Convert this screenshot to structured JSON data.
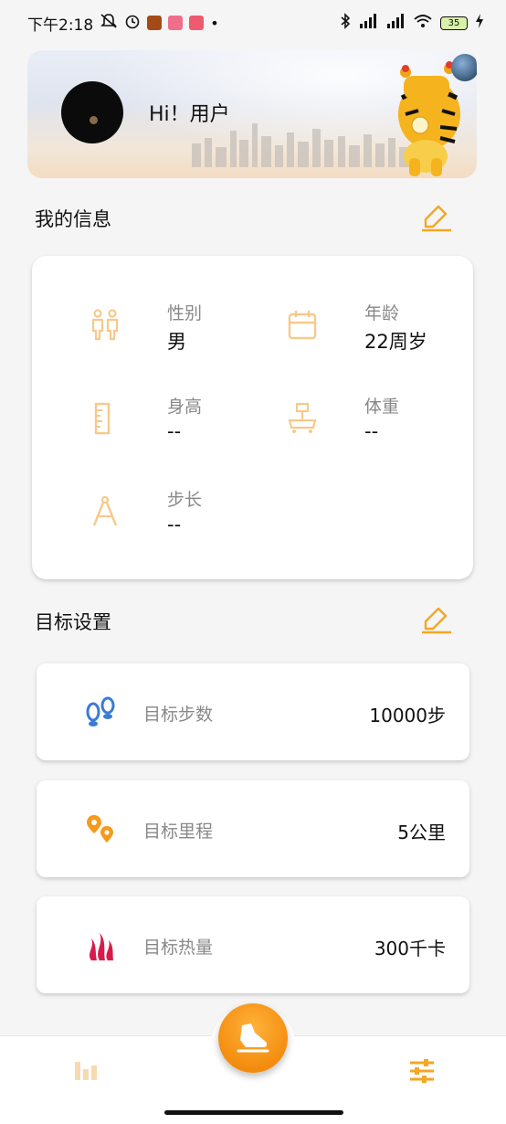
{
  "status_bar": {
    "time": "下午2:18",
    "battery": "35"
  },
  "header": {
    "greeting": "Hi！用户",
    "avatar_icon": "avatar-dark-circle",
    "mascot_icon": "tiger-mascot"
  },
  "my_info": {
    "title": "我的信息",
    "edit_icon": "edit-icon",
    "items": [
      {
        "icon": "gender-icon",
        "label": "性别",
        "value": "男"
      },
      {
        "icon": "calendar-icon",
        "label": "年龄",
        "value": "22周岁"
      },
      {
        "icon": "ruler-icon",
        "label": "身高",
        "value": "--"
      },
      {
        "icon": "scale-icon",
        "label": "体重",
        "value": "--"
      },
      {
        "icon": "compass-icon",
        "label": "步长",
        "value": "--"
      }
    ]
  },
  "goals": {
    "title": "目标设置",
    "edit_icon": "edit-icon",
    "items": [
      {
        "icon": "footsteps-icon",
        "label": "目标步数",
        "value": "10000步"
      },
      {
        "icon": "location-pins-icon",
        "label": "目标里程",
        "value": "5公里"
      },
      {
        "icon": "flame-icon",
        "label": "目标热量",
        "value": "300千卡"
      }
    ]
  },
  "nav": {
    "left_icon": "stats-icon",
    "center_icon": "running-shoe-icon",
    "right_icon": "settings-sliders-icon"
  },
  "colors": {
    "accent": "#f5a623",
    "accent_light": "#f7c98a",
    "step_blue": "#3a7bd5",
    "flame_red": "#d81b4a"
  }
}
